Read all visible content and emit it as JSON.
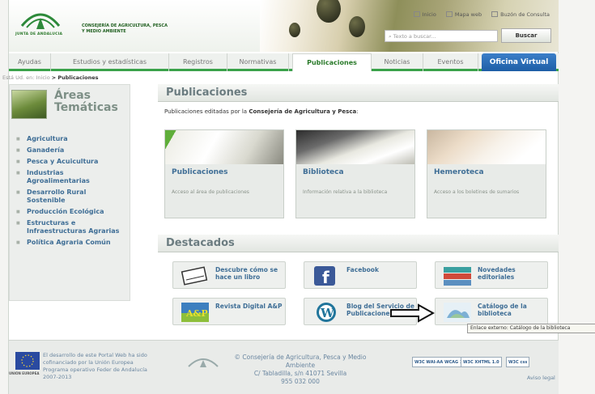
{
  "header": {
    "logo_caption": "JUNTA DE ANDALUCIA",
    "org_line1": "CONSEJERÍA DE AGRICULTURA, PESCA",
    "org_line2": "Y MEDIO AMBIENTE",
    "top_links": [
      "Inicio",
      "Mapa web",
      "Buzón de Consulta"
    ],
    "search_placeholder": "Texto a buscar...",
    "search_button": "Buscar"
  },
  "nav": {
    "tabs": [
      "Ayudas",
      "Estudios y estadísticas",
      "Registros",
      "Normativas",
      "Publicaciones",
      "Noticias",
      "Eventos",
      "Oficina Virtual"
    ],
    "active": "Publicaciones"
  },
  "breadcrumb": {
    "prefix": "Está Ud. en:",
    "home": "Inicio",
    "separator": ">",
    "current": "Publicaciones"
  },
  "sidebar": {
    "title_line1": "Áreas",
    "title_line2": "Temáticas",
    "items": [
      "Agricultura",
      "Ganadería",
      "Pesca y Acuicultura",
      "Industrias Agroalimentarias",
      "Desarrollo Rural Sostenible",
      "Producción Ecológica",
      "Estructuras e Infraestructuras Agrarias",
      "Política Agraria Común"
    ]
  },
  "main": {
    "section_title": "Publicaciones",
    "intro_prefix": "Publicaciones editadas por la",
    "intro_org": "Consejería de Agricultura y Pesca",
    "intro_suffix": ":",
    "cards": [
      {
        "title": "Publicaciones",
        "desc": "Acceso al área de publicaciones"
      },
      {
        "title": "Biblioteca",
        "desc": "Información relativa a la biblioteca"
      },
      {
        "title": "Hemeroteca",
        "desc": "Acceso a los boletines de sumarios"
      }
    ],
    "destacados_title": "Destacados",
    "destacados": [
      {
        "label": "Descubre cómo se hace un libro",
        "icon": "book-icon"
      },
      {
        "label": "Facebook",
        "icon": "facebook-icon"
      },
      {
        "label": "Novedades editoriales",
        "icon": "books-stack-icon"
      },
      {
        "label": "Revista Digital A&P",
        "icon": "magazine-icon"
      },
      {
        "label": "Blog del Servicio de Publicaciones",
        "icon": "wordpress-icon"
      },
      {
        "label": "Catálogo de la biblioteca",
        "icon": "catalog-icon"
      }
    ],
    "tooltip": "Enlace externo: Catálogo de la biblioteca"
  },
  "footer": {
    "eu_caption": "UNIÓN EUROPEA",
    "funding_line1": "El desarrollo de este Portal Web ha sido",
    "funding_line2": "cofinanciado por la Unión Europea",
    "funding_line3": "Programa operativo Feder de Andalucía",
    "funding_line4": "2007-2013",
    "copyright_line1": "© Consejería de Agricultura, Pesca y Medio",
    "copyright_line2": "Ambiente",
    "address": "C/ Tabladilla, s/n 41071 Sevilla",
    "phone": "955 032 000",
    "badges": [
      "WAI-AA WCAG 1.0",
      "XHTML 1.0",
      "css"
    ],
    "aviso": "Aviso legal"
  },
  "colors": {
    "brand_green": "#3aa24a",
    "link_blue": "#3f6e96",
    "virtual_office_blue": "#1e5ea6"
  }
}
